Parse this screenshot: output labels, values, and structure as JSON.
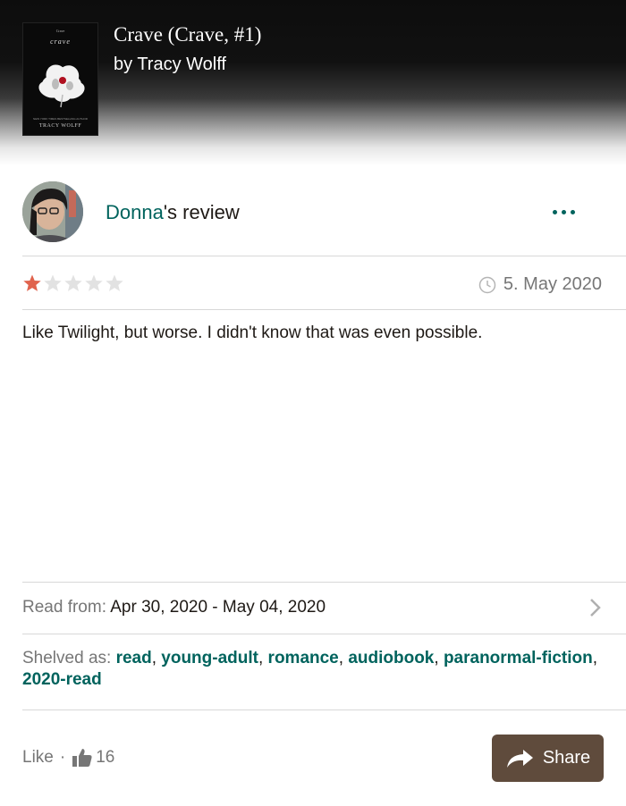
{
  "book": {
    "title": "Crave (Crave, #1)",
    "author": "by Tracy Wolff",
    "cover": {
      "top_text": "Crave",
      "title_text": "crave",
      "tag_text": "NEW YORK TIMES BESTSELLING AUTHOR",
      "author_text": "TRACY WOLFF"
    }
  },
  "review": {
    "reviewer_name": "Donna",
    "reviewer_suffix": "'s review",
    "more_icon": "ellipsis-icon",
    "rating": 1,
    "max_rating": 5,
    "star_colors": {
      "filled": "#e0634d",
      "empty": "#e2e2e2"
    },
    "date": "5. May 2020",
    "text": "Like Twilight, but worse. I didn't know that was even possible."
  },
  "reading": {
    "label": "Read from:",
    "range": "Apr 30, 2020 - May 04, 2020"
  },
  "shelves": {
    "label": "Shelved as:",
    "items": [
      "read",
      "young-adult",
      "romance",
      "audiobook",
      "paranormal-fiction",
      "2020-read"
    ]
  },
  "footer": {
    "like_label": "Like",
    "like_separator": "·",
    "like_count": "16",
    "share_label": "Share"
  },
  "colors": {
    "accent": "#00635d",
    "share_button": "#5f4b3c",
    "muted": "#767676"
  }
}
